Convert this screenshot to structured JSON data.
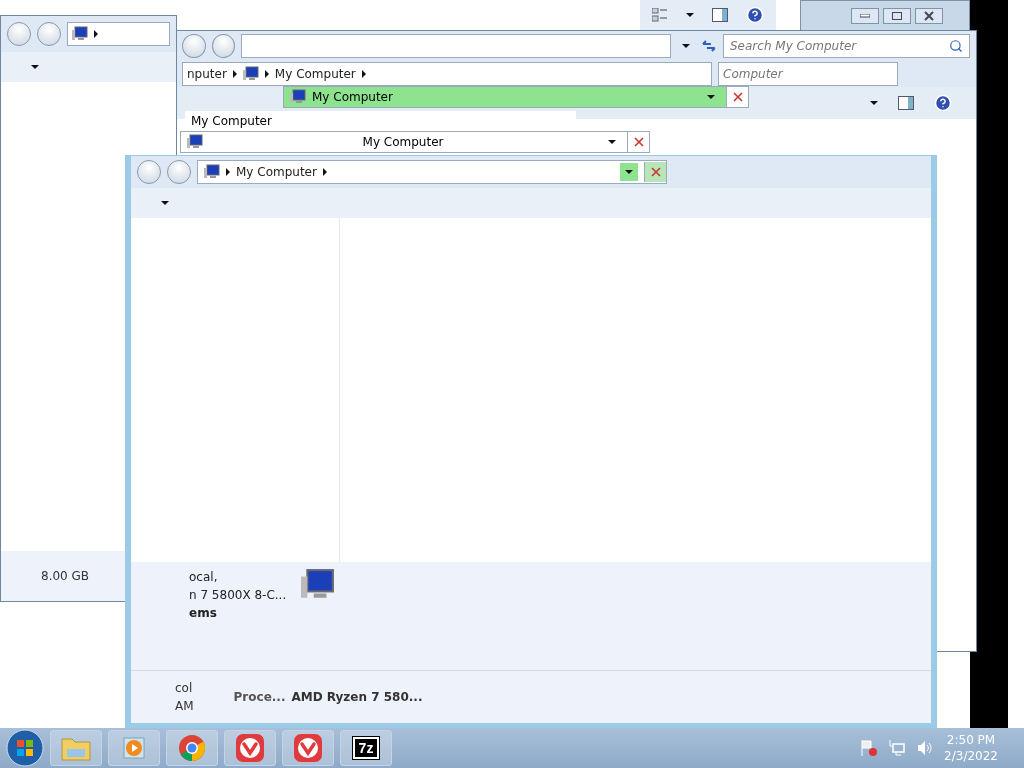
{
  "left_window": {
    "status_text": "8.00 GB"
  },
  "back_window": {
    "breadcrumb": [
      "nputer",
      "My Computer"
    ],
    "search": {
      "placeholder": "Search My Computer"
    },
    "search_2": {
      "placeholder": "Computer"
    }
  },
  "address_fragments": [
    {
      "text": "My Computer",
      "highlighted": true
    },
    {
      "text": "My Computer",
      "highlighted": false
    }
  ],
  "crumb_fragment": {
    "text": "My Computer"
  },
  "front_window": {
    "breadcrumb": [
      "My Computer"
    ],
    "dropdown_highlighted": true,
    "details": [
      {
        "text": "ocal,",
        "bold": false
      },
      {
        "text": "n 7 5800X 8-C...",
        "bold": false
      },
      {
        "text": "ems",
        "bold": true
      }
    ],
    "status": {
      "line_1": "col",
      "line_2": "AM",
      "label": "Proce...",
      "value": "AMD Ryzen 7 580..."
    }
  },
  "taskbar": {
    "apps": [
      {
        "kind": "explorer"
      },
      {
        "kind": "media"
      },
      {
        "kind": "chrome"
      },
      {
        "kind": "vivaldi"
      },
      {
        "kind": "vivaldi"
      },
      {
        "kind": "archiver",
        "label": "7z"
      }
    ],
    "clock": {
      "time": "2:50 PM",
      "date": "2/3/2022"
    }
  }
}
